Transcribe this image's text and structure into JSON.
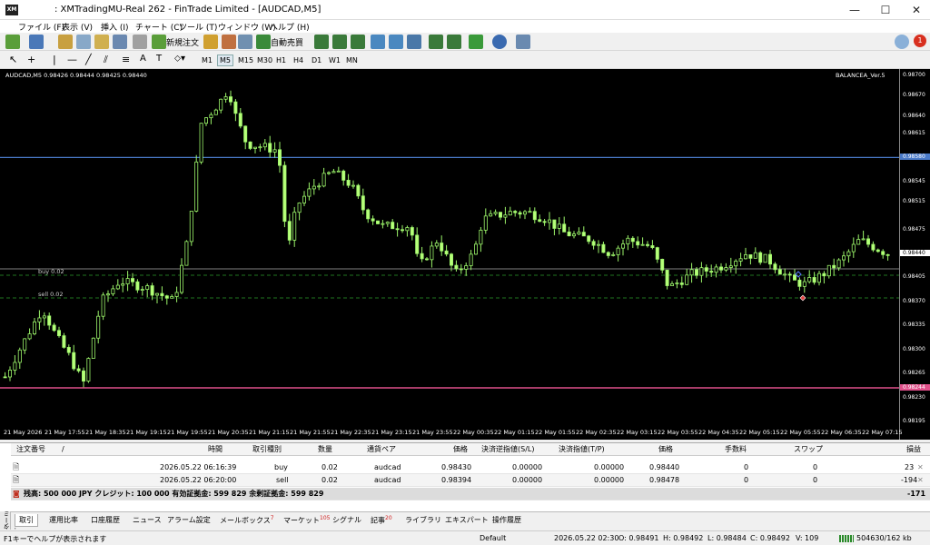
{
  "window": {
    "title": ": XMTradingMU-Real 262 - FinTrade Limited - [AUDCAD,M5]",
    "logo": "XM",
    "min": "—",
    "max": "☐",
    "close": "✕"
  },
  "menu": [
    "ファイル (F)",
    "表示 (V)",
    "挿入 (I)",
    "チャート (C)",
    "ツール (T)",
    "ウィンドウ (W)",
    "ヘルプ (H)"
  ],
  "toolbar": {
    "new_order": "新規注文",
    "auto_trade": "自動売買",
    "notify_count": "1"
  },
  "timeframes": [
    "M1",
    "M5",
    "M15",
    "M30",
    "H1",
    "H4",
    "D1",
    "W1",
    "MN"
  ],
  "active_timeframe": "M5",
  "chart": {
    "header": "AUDCAD,M5  0.98426 0.98444 0.98425 0.98440",
    "indicator": "BALANCEA_Ver.5",
    "y_ticks": [
      "0.98700",
      "0.98685",
      "0.98670",
      "0.98655",
      "0.98640",
      "0.98625",
      "0.98610",
      "0.98595",
      "0.98580",
      "0.98565",
      "0.98550",
      "0.98535",
      "0.98520",
      "0.98505",
      "0.98490",
      "0.98475",
      "0.98460",
      "0.98445",
      "0.98430",
      "0.98415",
      "0.98400",
      "0.98385",
      "0.98370",
      "0.98355",
      "0.98340",
      "0.98325",
      "0.98310",
      "0.98295",
      "0.98280",
      "0.98265",
      "0.98250",
      "0.98235",
      "0.98220",
      "0.98205",
      "0.98190"
    ],
    "y_labels": [
      "0.98700",
      "0.98670",
      "0.98640",
      "0.98615",
      "0.98580",
      "0.98545",
      "0.98515",
      "0.98475",
      "0.98440",
      "0.98405",
      "0.98370",
      "0.98335",
      "0.98300",
      "0.98265",
      "0.98244",
      "0.98230",
      "0.98195"
    ],
    "line_blue": "0.98580",
    "line_pink": "0.98244",
    "line_price": "0.98440",
    "buy_label": "buy 0.02",
    "sell_label": "sell 0.02",
    "x_labels": [
      "21 May 2026",
      "21 May 17:55",
      "21 May 18:35",
      "21 May 19:15",
      "21 May 19:55",
      "21 May 20:35",
      "21 May 21:15",
      "21 May 21:55",
      "21 May 22:35",
      "21 May 23:15",
      "21 May 23:55",
      "22 May 00:35",
      "22 May 01:15",
      "22 May 01:55",
      "22 May 02:35",
      "22 May 03:15",
      "22 May 03:55",
      "22 May 04:35",
      "22 May 05:15",
      "22 May 05:55",
      "22 May 06:35",
      "22 May 07:15"
    ]
  },
  "terminal": {
    "headers": [
      "注文番号",
      "/",
      "時間",
      "取引種別",
      "数量",
      "通貨ペア",
      "価格",
      "決済逆指値(S/L)",
      "決済指値(T/P)",
      "価格",
      "手数料",
      "スワップ",
      "損益"
    ],
    "rows": [
      [
        "",
        "2026.05.22 06:16:39",
        "buy",
        "0.02",
        "audcad",
        "0.98430",
        "0.00000",
        "0.00000",
        "0.98440",
        "0",
        "0",
        "23"
      ],
      [
        "",
        "2026.05.22 06:20:00",
        "sell",
        "0.02",
        "audcad",
        "0.98394",
        "0.00000",
        "0.00000",
        "0.98478",
        "0",
        "0",
        "-194"
      ]
    ],
    "summary": "残高: 500 000 JPY  クレジット: 100 000  有効証拠金: 599 829  余剰証拠金: 599 829",
    "summary_total": "-171",
    "side_label": "ターミナル",
    "tabs": [
      "取引",
      "運用比率",
      "口座履歴",
      "ニュース",
      "アラーム設定",
      "メールボックス",
      "マーケット",
      "シグナル",
      "記事",
      "ライブラリ",
      "エキスパート",
      "操作履歴"
    ],
    "tab_badges": {
      "mail": "7",
      "market": "105",
      "article": "20"
    }
  },
  "status": {
    "help": "F1キーでヘルプが表示されます",
    "profile": "Default",
    "time": "2026.05.22 02:30",
    "o": "O: 0.98491",
    "h": "H: 0.98492",
    "l": "L: 0.98484",
    "c": "C: 0.98492",
    "v": "V: 109",
    "traffic": "504630/162 kb"
  }
}
